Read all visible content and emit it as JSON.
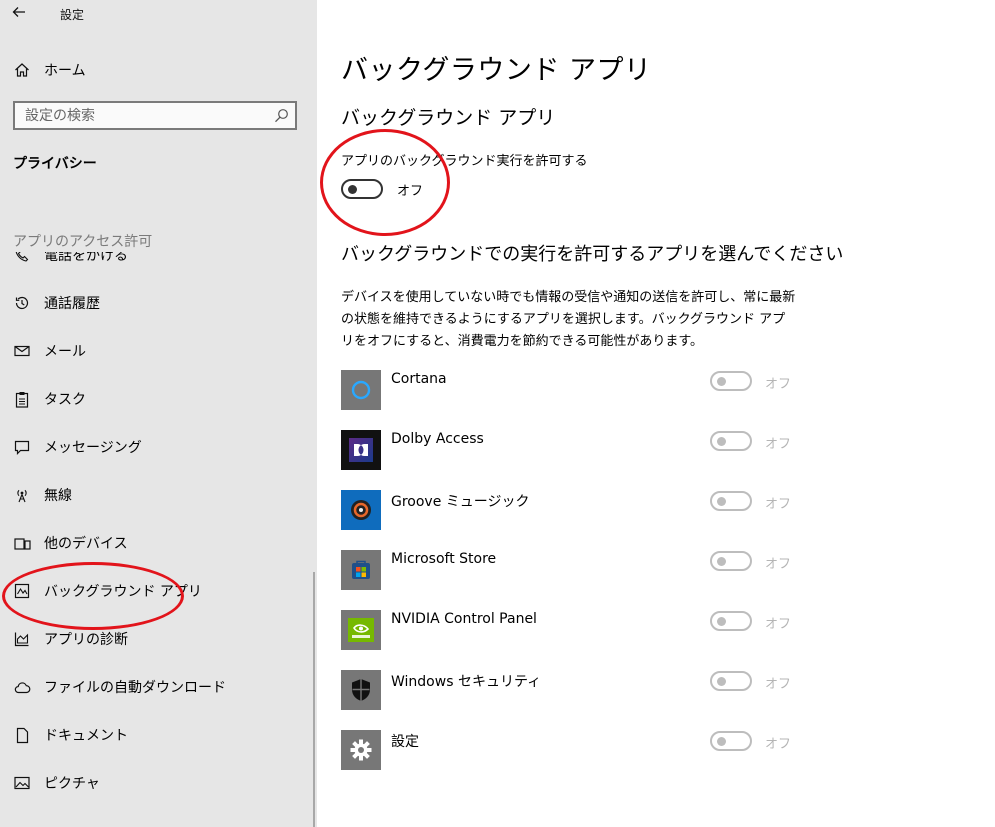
{
  "window": {
    "title": "設定"
  },
  "sidebar": {
    "home_label": "ホーム",
    "search_placeholder": "設定の検索",
    "privacy_heading": "プライバシー",
    "section_label": "アプリのアクセス許可",
    "items": [
      {
        "label": "電話をかける",
        "icon": "phone-icon"
      },
      {
        "label": "通話履歴",
        "icon": "history-icon"
      },
      {
        "label": "メール",
        "icon": "mail-icon"
      },
      {
        "label": "タスク",
        "icon": "clipboard-icon"
      },
      {
        "label": "メッセージング",
        "icon": "chat-icon"
      },
      {
        "label": "無線",
        "icon": "antenna-icon"
      },
      {
        "label": "他のデバイス",
        "icon": "devices-icon"
      },
      {
        "label": "バックグラウンド アプリ",
        "icon": "background-apps-icon",
        "selected": true
      },
      {
        "label": "アプリの診断",
        "icon": "diagnostics-icon"
      },
      {
        "label": "ファイルの自動ダウンロード",
        "icon": "cloud-icon"
      },
      {
        "label": "ドキュメント",
        "icon": "document-icon"
      },
      {
        "label": "ピクチャ",
        "icon": "picture-icon"
      }
    ]
  },
  "main": {
    "page_title": "バックグラウンド アプリ",
    "sub_heading": "バックグラウンド アプリ",
    "master_toggle": {
      "label": "アプリのバックグラウンド実行を許可する",
      "state": "オフ",
      "on": false
    },
    "choose_heading": "バックグラウンドでの実行を許可するアプリを選んでください",
    "description": "デバイスを使用していない時でも情報の受信や通知の送信を許可し、常に最新の状態を維持できるようにするアプリを選択します。バックグラウンド アプリをオフにすると、消費電力を節約できる可能性があります。",
    "apps": [
      {
        "name": "Cortana",
        "state": "オフ",
        "on": false,
        "icon": "cortana-icon",
        "icon_bg": "#777777"
      },
      {
        "name": "Dolby Access",
        "state": "オフ",
        "on": false,
        "icon": "dolby-icon",
        "icon_bg": "#111111"
      },
      {
        "name": "Groove ミュージック",
        "state": "オフ",
        "on": false,
        "icon": "groove-music-icon",
        "icon_bg": "#0f6cbd"
      },
      {
        "name": "Microsoft Store",
        "state": "オフ",
        "on": false,
        "icon": "store-icon",
        "icon_bg": "#777777"
      },
      {
        "name": "NVIDIA Control Panel",
        "state": "オフ",
        "on": false,
        "icon": "nvidia-icon",
        "icon_bg": "#777777"
      },
      {
        "name": "Windows セキュリティ",
        "state": "オフ",
        "on": false,
        "icon": "shield-icon",
        "icon_bg": "#777777"
      },
      {
        "name": "設定",
        "state": "オフ",
        "on": false,
        "icon": "gear-icon",
        "icon_bg": "#777777"
      }
    ]
  },
  "colors": {
    "annotation": "#e2141b",
    "sidebar_bg": "#e6e6e6",
    "toggle_off": "#333333",
    "toggle_disabled": "#bdbdbd"
  }
}
